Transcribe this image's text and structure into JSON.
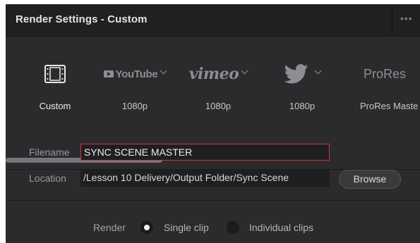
{
  "header": {
    "title": "Render Settings - Custom",
    "more_label": "•••"
  },
  "presets": [
    {
      "name": "Custom",
      "icon": "film-strip-icon",
      "label": "Custom",
      "selected": true
    },
    {
      "name": "YouTube",
      "icon": "youtube-logo",
      "logo_text": "YouTube",
      "label": "1080p",
      "has_dropdown": true
    },
    {
      "name": "Vimeo",
      "icon": "vimeo-logo",
      "logo_text": "vimeo",
      "label": "1080p",
      "has_dropdown": true
    },
    {
      "name": "Twitter",
      "icon": "twitter-bird-icon",
      "label": "1080p",
      "has_dropdown": true
    },
    {
      "name": "ProRes",
      "icon": "prores-logo",
      "logo_text": "ProRes",
      "label": "ProRes Maste"
    }
  ],
  "file": {
    "filename_label": "Filename",
    "filename_value": "SYNC SCENE MASTER",
    "location_label": "Location",
    "location_value": "/Lesson 10 Delivery/Output Folder/Sync Scene",
    "browse_label": "Browse"
  },
  "render": {
    "label": "Render",
    "options": [
      {
        "label": "Single clip",
        "selected": true
      },
      {
        "label": "Individual clips",
        "selected": false
      }
    ]
  },
  "colors": {
    "panel_bg": "#2b2b2d",
    "header_bg": "#202022",
    "focus_border": "#c8393c",
    "field_bg": "#1f1f21"
  }
}
